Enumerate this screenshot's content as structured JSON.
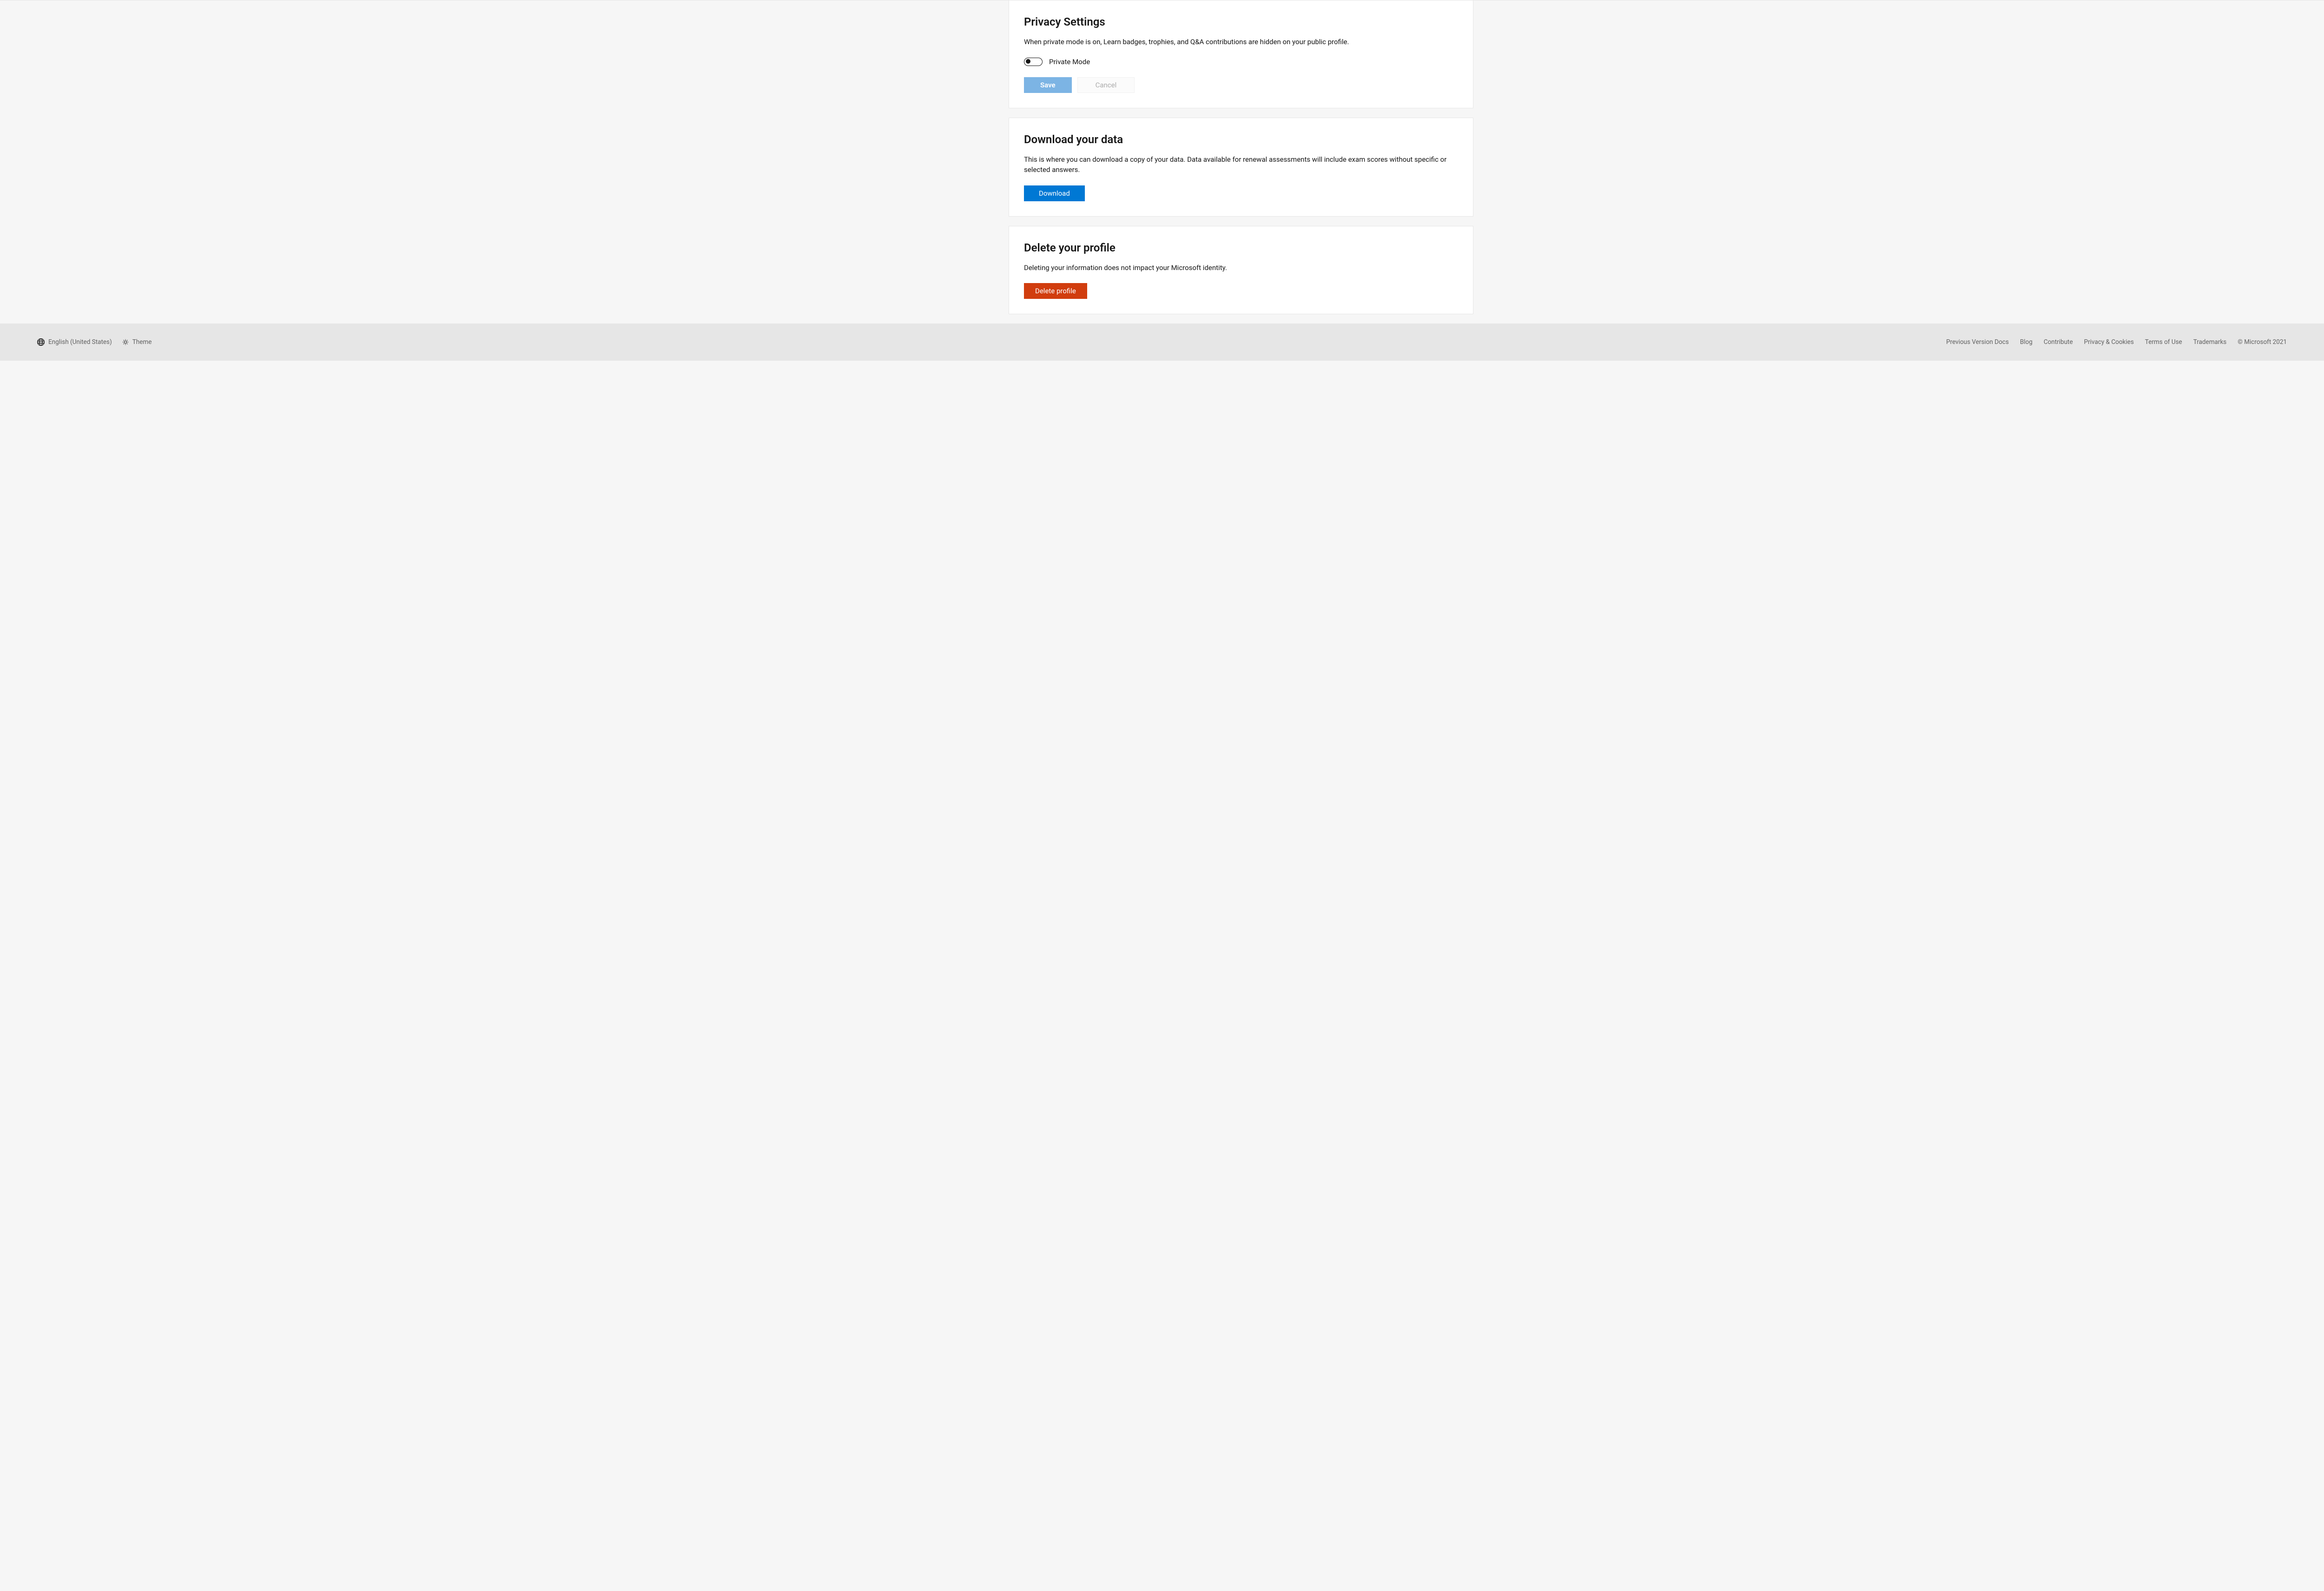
{
  "privacy": {
    "title": "Privacy Settings",
    "description": "When private mode is on, Learn badges, trophies, and Q&A contributions are hidden on your public profile.",
    "toggle_label": "Private Mode",
    "save_label": "Save",
    "cancel_label": "Cancel"
  },
  "download": {
    "title": "Download your data",
    "description": "This is where you can download a copy of your data. Data available for renewal assessments will include exam scores without specific or selected answers.",
    "button_label": "Download"
  },
  "delete": {
    "title": "Delete your profile",
    "description": "Deleting your information does not impact your Microsoft identity.",
    "button_label": "Delete profile"
  },
  "footer": {
    "language": "English (United States)",
    "theme": "Theme",
    "links": {
      "prev_docs": "Previous Version Docs",
      "blog": "Blog",
      "contribute": "Contribute",
      "privacy": "Privacy & Cookies",
      "terms": "Terms of Use",
      "trademarks": "Trademarks"
    },
    "copyright": "© Microsoft 2021"
  }
}
